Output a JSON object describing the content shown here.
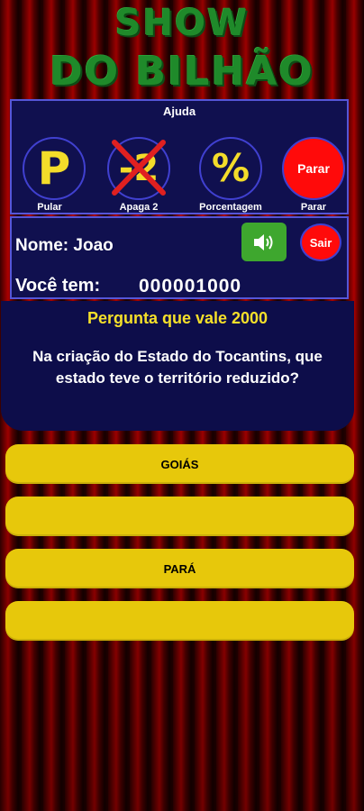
{
  "logo": {
    "line1": "SHOW",
    "line2": "DO BILHÃO"
  },
  "help": {
    "title": "Ajuda",
    "buttons": [
      {
        "label": "Pular",
        "glyph": "P"
      },
      {
        "label": "Apaga 2",
        "glyph": "-2"
      },
      {
        "label": "Porcentagem",
        "glyph": "%"
      },
      {
        "label": "Parar",
        "inner_label": "Parar"
      }
    ]
  },
  "player": {
    "name": "Nome: Joao",
    "money_label": "Você tem:",
    "money_value": "000001000"
  },
  "controls": {
    "exit_label": "Sair",
    "sound_icon": "speaker-icon"
  },
  "question": {
    "value_text": "Pergunta que vale 2000",
    "text": "Na criação do Estado do Tocantins, que estado teve o território reduzido?"
  },
  "answers": [
    "GOIÁS",
    "",
    "PARÁ",
    ""
  ],
  "colors": {
    "panel": "#10104f",
    "panel_border": "#5656d8",
    "answer": "#e7c80b",
    "accent_yellow": "#f3dc2a",
    "logo_green": "#1f8a2a",
    "red_button": "#ff0a0a",
    "sound_green": "#3ea72e"
  }
}
